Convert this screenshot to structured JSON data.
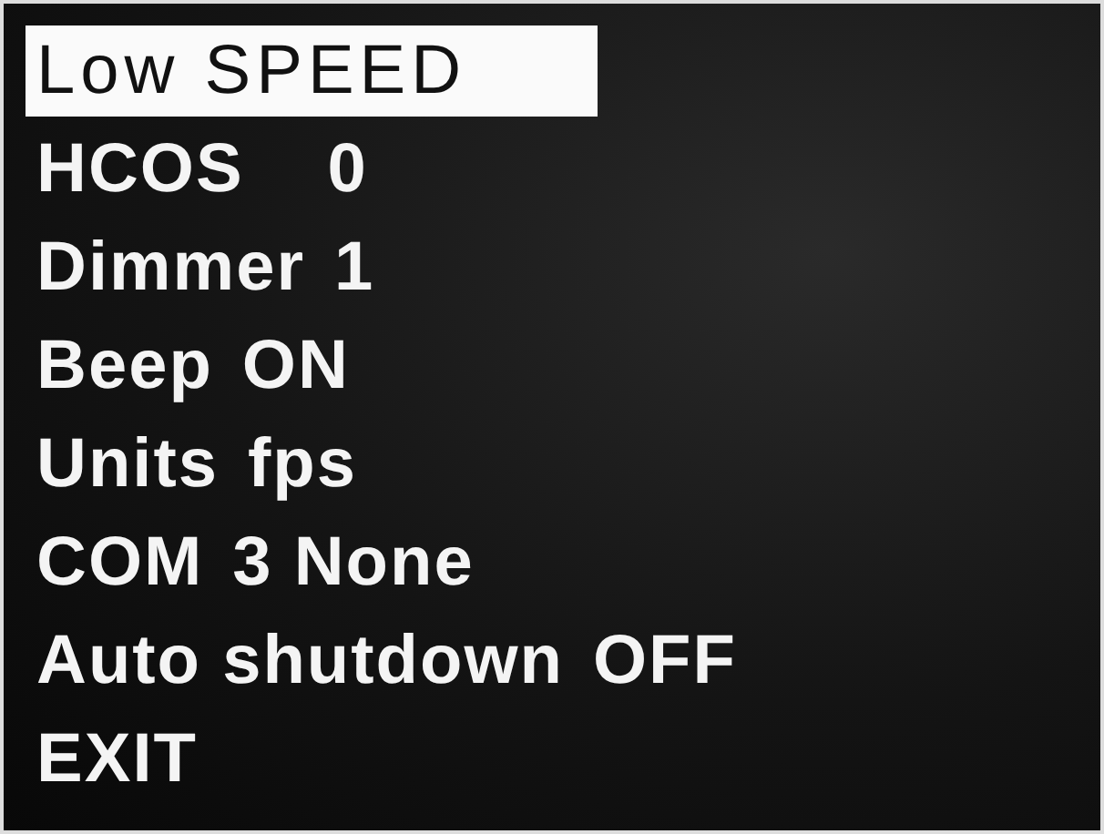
{
  "menu": {
    "items": [
      {
        "label": "Low SPEED",
        "selected": true
      },
      {
        "label": "HCOS",
        "value": "0",
        "selected": false
      },
      {
        "label": "Dimmer",
        "value": "1",
        "selected": false
      },
      {
        "label": "Beep",
        "value": "ON",
        "selected": false
      },
      {
        "label": "Units",
        "value": "fps",
        "selected": false
      },
      {
        "label": "COM",
        "value": "3 None",
        "selected": false
      },
      {
        "label": "Auto shutdown",
        "value": "OFF",
        "selected": false
      },
      {
        "label": "EXIT",
        "selected": false
      }
    ]
  }
}
